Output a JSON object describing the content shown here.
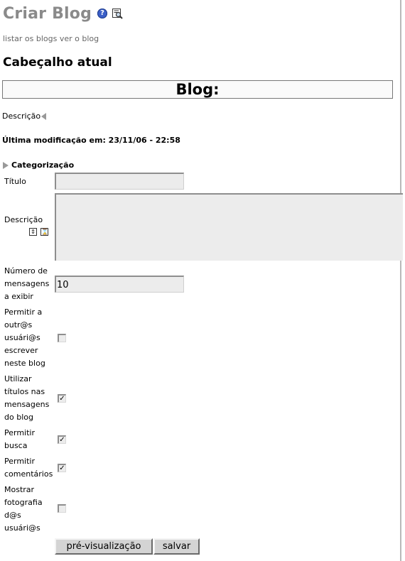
{
  "header": {
    "title": "Criar Blog",
    "help_icon_text": "?"
  },
  "links": {
    "list_blogs": "listar os blogs",
    "view_blog": "ver o blog"
  },
  "section_title": "Cabeçalho atual",
  "blog_box_text": "Blog:",
  "description_label": "Descrição",
  "last_modified": "Última modificação em: 23/11/06 - 22:58",
  "categorization": "Categorização",
  "form": {
    "title_label": "Título",
    "title_value": "",
    "description_label": "Descrição",
    "num_messages_label": [
      "Número de",
      "mensagens",
      "a exibir"
    ],
    "num_messages_value": "10",
    "allow_others_label": [
      "Permitir a",
      "outr@s",
      "usuári@s",
      "escrever",
      "neste blog"
    ],
    "allow_others_checked": false,
    "use_titles_label": [
      "Utilizar",
      "títulos nas",
      "mensagens",
      "do blog"
    ],
    "use_titles_checked": true,
    "allow_search_label": [
      "Permitir",
      "busca"
    ],
    "allow_search_checked": true,
    "allow_comments_label": [
      "Permitir",
      "comentários"
    ],
    "allow_comments_checked": true,
    "show_photo_label": [
      "Mostrar",
      "fotografia",
      "d@s",
      "usuári@s"
    ],
    "show_photo_checked": false,
    "check_mark": "✓"
  },
  "buttons": {
    "preview": "pré-visualização",
    "save": "salvar"
  }
}
